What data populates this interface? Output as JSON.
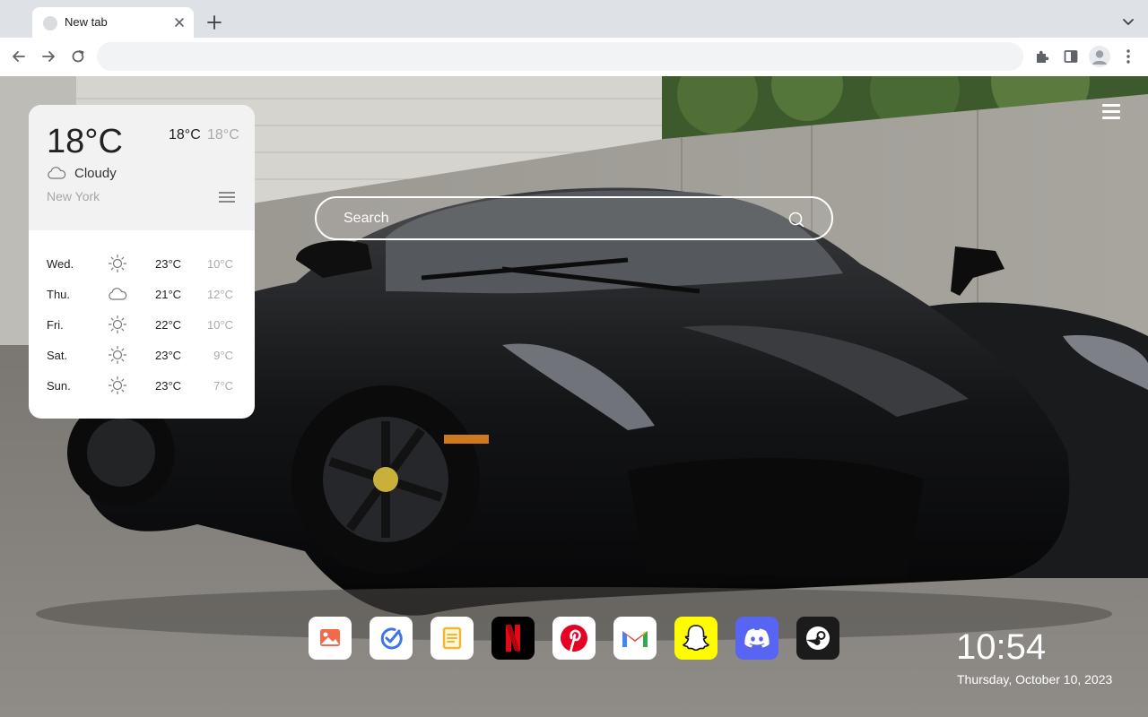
{
  "browser": {
    "tab_title": "New tab",
    "address_value": "",
    "address_placeholder": ""
  },
  "weather": {
    "current_temp": "18°C",
    "high": "18°C",
    "low": "18°C",
    "condition": "Cloudy",
    "condition_icon": "cloud-icon",
    "city": "New York",
    "forecast": [
      {
        "day": "Wed.",
        "icon": "sun-icon",
        "high": "23°C",
        "low": "10°C"
      },
      {
        "day": "Thu.",
        "icon": "cloud-icon",
        "high": "21°C",
        "low": "12°C"
      },
      {
        "day": "Fri.",
        "icon": "sun-icon",
        "high": "22°C",
        "low": "10°C"
      },
      {
        "day": "Sat.",
        "icon": "sun-icon",
        "high": "23°C",
        "low": "9°C"
      },
      {
        "day": "Sun.",
        "icon": "sun-icon",
        "high": "23°C",
        "low": "7°C"
      }
    ]
  },
  "search": {
    "placeholder": "Search"
  },
  "apps": [
    {
      "name": "photos",
      "icon": "photos-app-icon",
      "color": "#ffffff"
    },
    {
      "name": "tasks",
      "icon": "tasks-app-icon",
      "color": "#ffffff"
    },
    {
      "name": "notes",
      "icon": "notes-app-icon",
      "color": "#ffffff"
    },
    {
      "name": "netflix",
      "icon": "netflix-app-icon",
      "color": "#000000"
    },
    {
      "name": "pinterest",
      "icon": "pinterest-app-icon",
      "color": "#ffffff"
    },
    {
      "name": "gmail",
      "icon": "gmail-app-icon",
      "color": "#ffffff"
    },
    {
      "name": "snapchat",
      "icon": "snapchat-app-icon",
      "color": "#fffc00"
    },
    {
      "name": "discord",
      "icon": "discord-app-icon",
      "color": "#5865f2"
    },
    {
      "name": "steam",
      "icon": "steam-app-icon",
      "color": "#1b1b1b"
    }
  ],
  "clock": {
    "time": "10:54",
    "date": "Thursday, October 10, 2023"
  }
}
